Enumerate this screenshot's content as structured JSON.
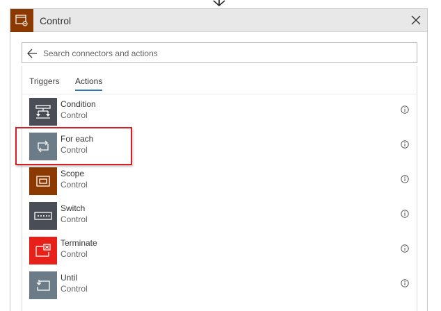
{
  "header": {
    "title": "Control",
    "icon": "control-icon",
    "icon_bg": "#8c3900",
    "close_icon": "close-icon"
  },
  "search": {
    "placeholder": "Search connectors and actions",
    "value": "",
    "back_icon": "back-arrow-icon"
  },
  "tabs": [
    {
      "label": "Triggers",
      "active": false
    },
    {
      "label": "Actions",
      "active": true
    }
  ],
  "actions": [
    {
      "name": "Condition",
      "connector": "Control",
      "icon": "condition-icon",
      "color": "#494e56"
    },
    {
      "name": "For each",
      "connector": "Control",
      "icon": "for-each-icon",
      "color": "#6b7b88",
      "highlighted": true
    },
    {
      "name": "Scope",
      "connector": "Control",
      "icon": "scope-icon",
      "color": "#8c3900"
    },
    {
      "name": "Switch",
      "connector": "Control",
      "icon": "switch-icon",
      "color": "#494e56"
    },
    {
      "name": "Terminate",
      "connector": "Control",
      "icon": "terminate-icon",
      "color": "#e8201a"
    },
    {
      "name": "Until",
      "connector": "Control",
      "icon": "until-icon",
      "color": "#6b7b88"
    }
  ],
  "colors": {
    "accent": "#2a7ab7",
    "highlight": "#d41f26"
  }
}
